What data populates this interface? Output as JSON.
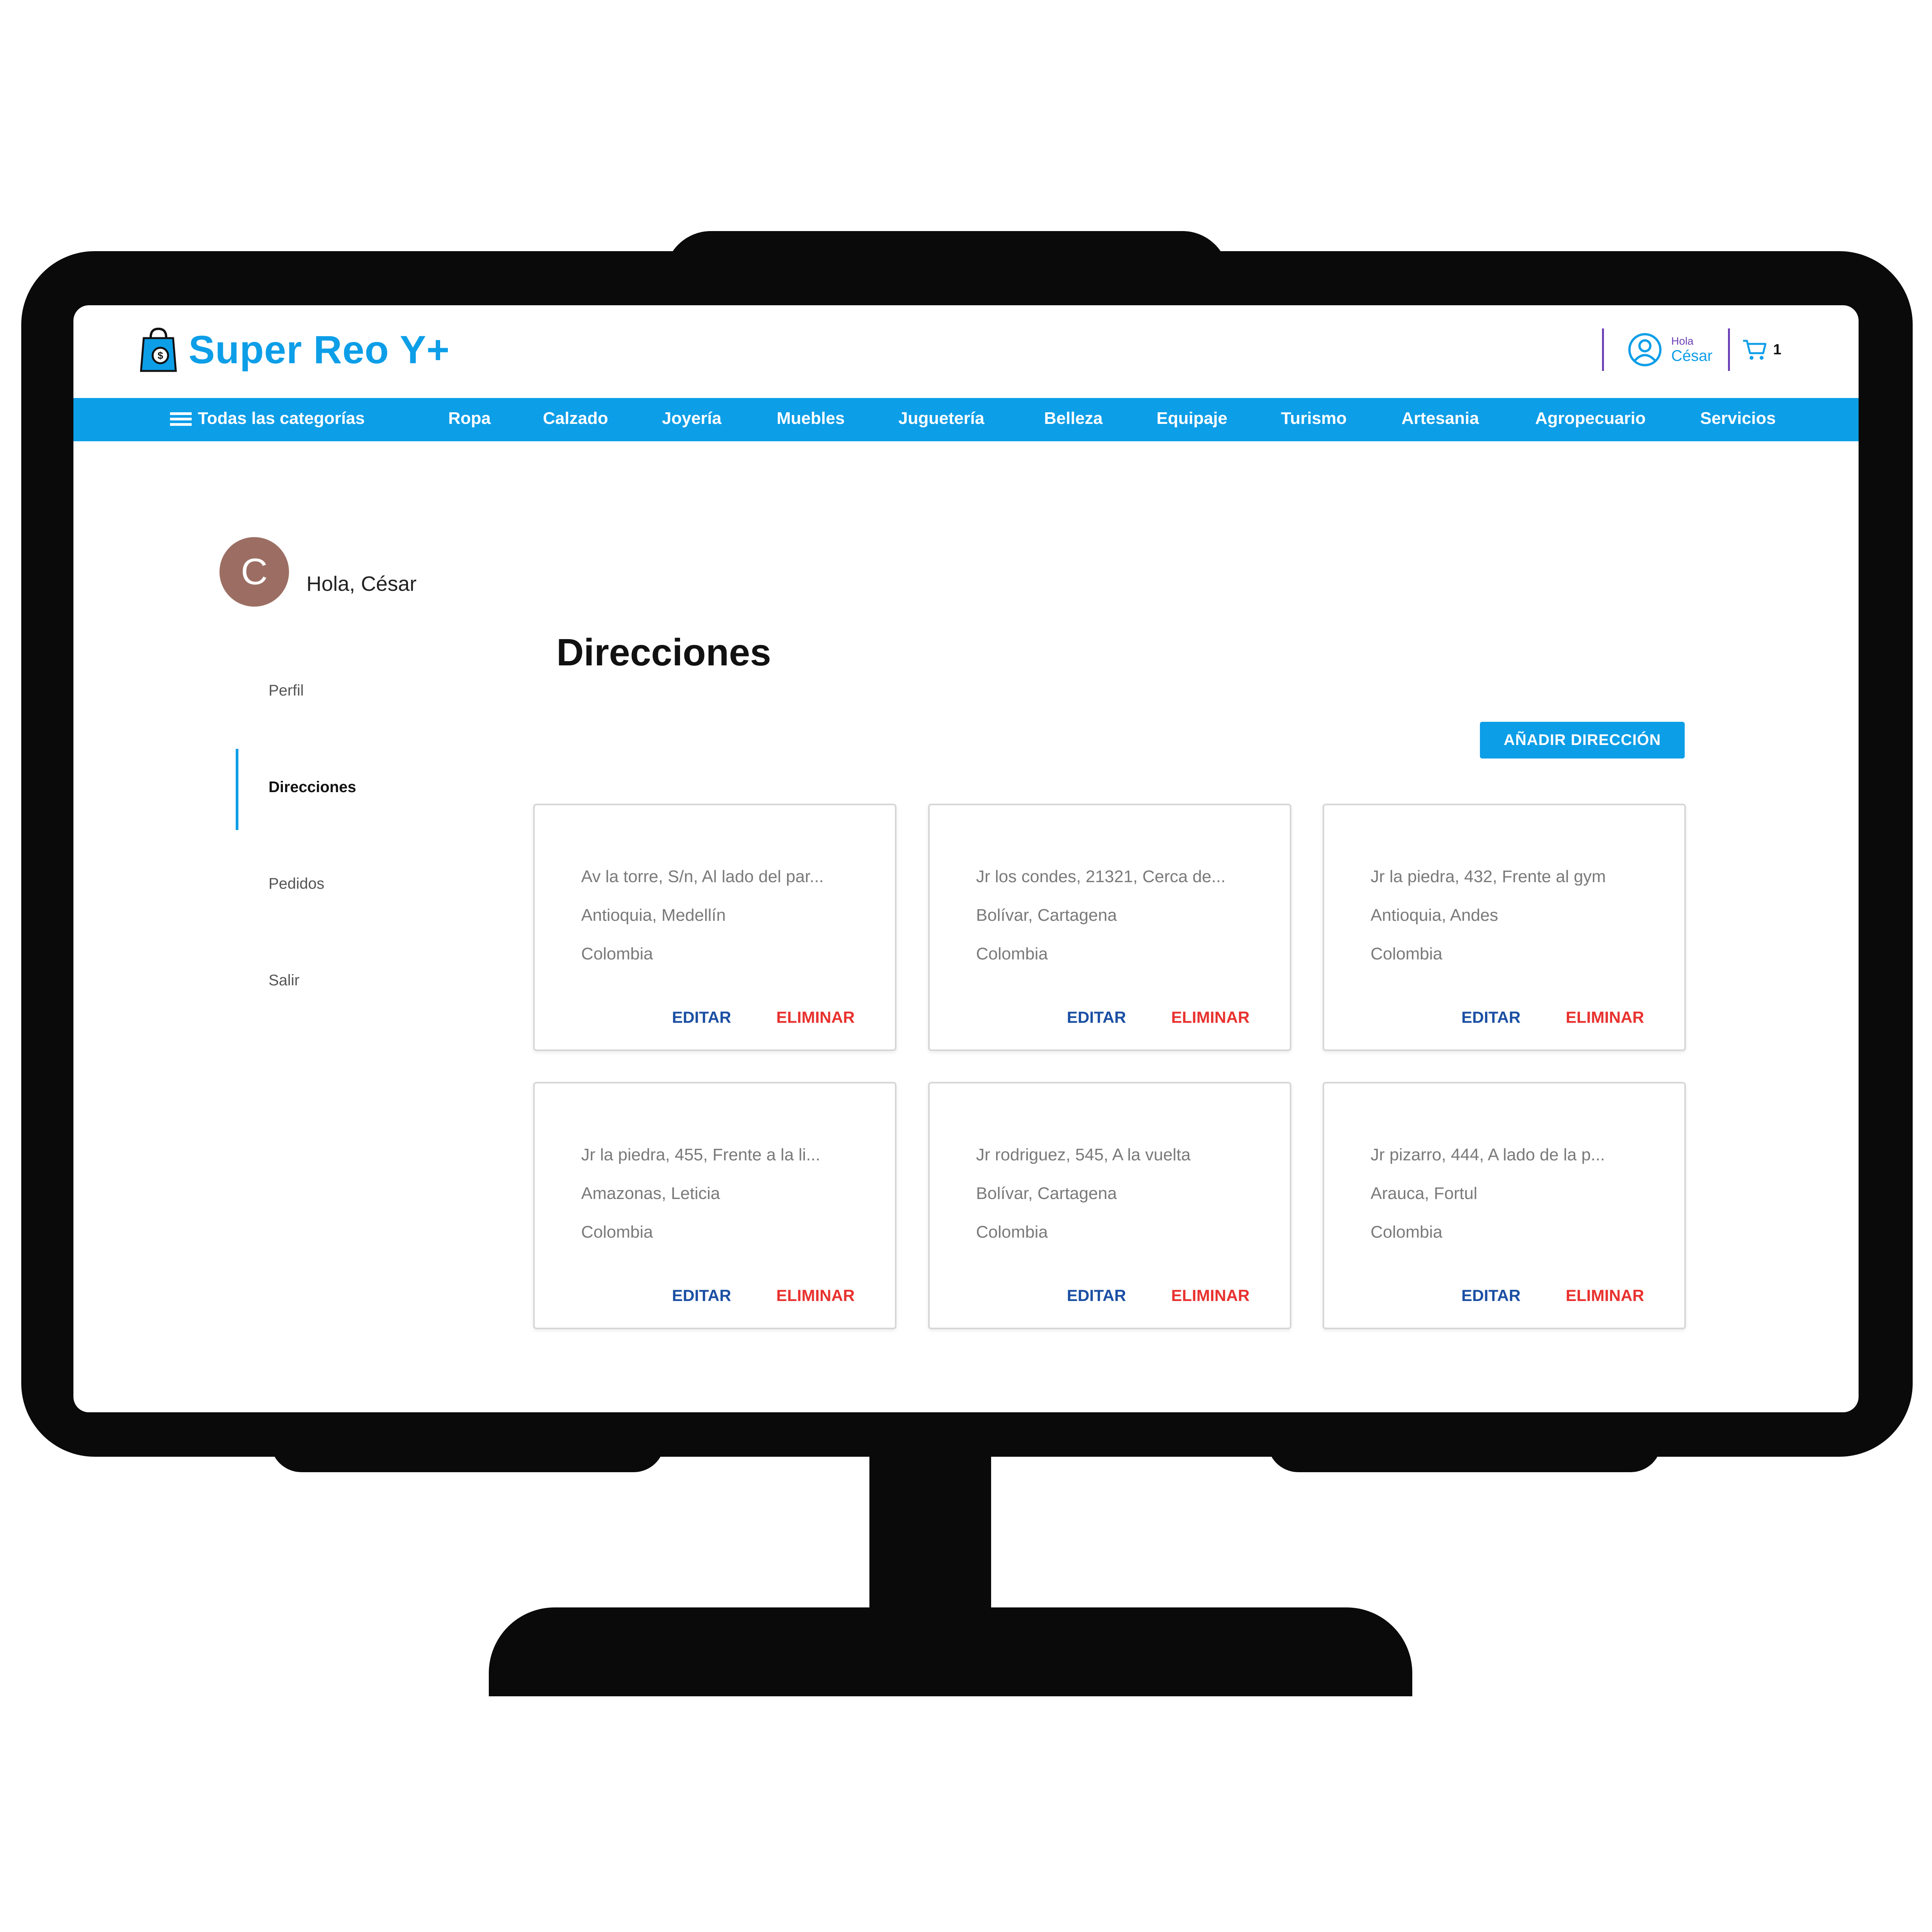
{
  "header": {
    "brand": "Super Reo Y+",
    "user_greeting": "Hola",
    "user_name": "César",
    "cart_count": "1"
  },
  "nav": {
    "all_categories": "Todas las categorías",
    "items": [
      "Ropa",
      "Calzado",
      "Joyería",
      "Muebles",
      "Juguetería",
      "Belleza",
      "Equipaje",
      "Turismo",
      "Artesania",
      "Agropecuario",
      "Servicios"
    ]
  },
  "sidebar": {
    "avatar_letter": "C",
    "greeting": "Hola, César",
    "items": [
      "Perfil",
      "Direcciones",
      "Pedidos",
      "Salir"
    ],
    "active": "Direcciones"
  },
  "main": {
    "title": "Direcciones",
    "add_button": "AÑADIR DIRECCIÓN",
    "edit_label": "EDITAR",
    "delete_label": "ELIMINAR",
    "addresses": [
      {
        "line1": "Av la torre, S/n, Al lado del par...",
        "line2": "Antioquia, Medellín",
        "line3": "Colombia"
      },
      {
        "line1": "Jr los condes, 21321, Cerca de...",
        "line2": "Bolívar, Cartagena",
        "line3": "Colombia"
      },
      {
        "line1": "Jr la piedra, 432, Frente al gym",
        "line2": "Antioquia, Andes",
        "line3": "Colombia"
      },
      {
        "line1": "Jr la piedra, 455, Frente a la li...",
        "line2": "Amazonas, Leticia",
        "line3": "Colombia"
      },
      {
        "line1": "Jr rodriguez, 545, A la vuelta",
        "line2": "Bolívar, Cartagena",
        "line3": "Colombia"
      },
      {
        "line1": "Jr pizarro, 444, A lado de la p...",
        "line2": "Arauca, Fortul",
        "line3": "Colombia"
      }
    ]
  },
  "colors": {
    "brand_blue": "#0d9ee8",
    "edit_blue": "#1b4fa3",
    "delete_red": "#e8322f",
    "avatar_bg": "#9c6e63",
    "accent_purple": "#6a3fb5"
  }
}
